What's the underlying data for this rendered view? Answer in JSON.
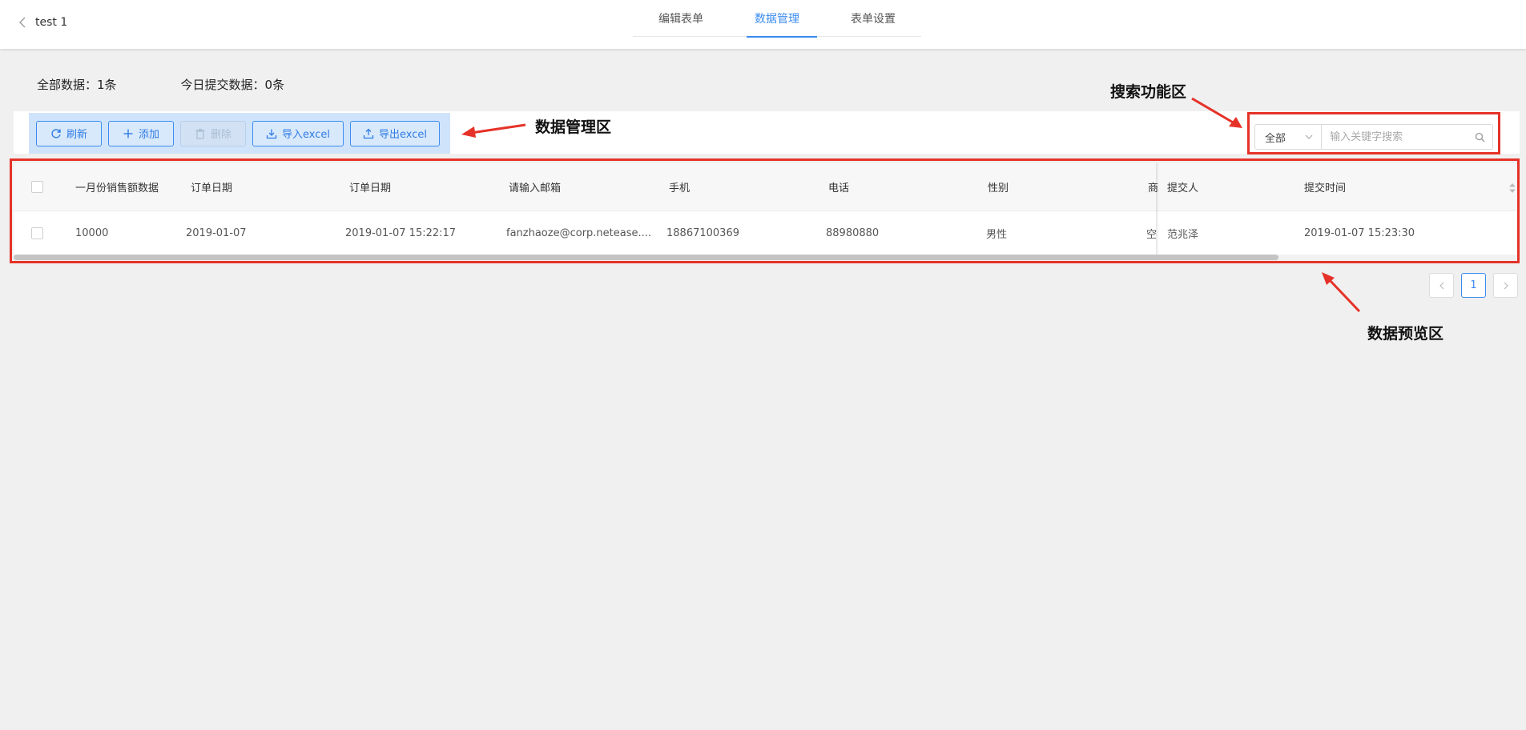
{
  "header": {
    "back_label": "test 1",
    "tabs": [
      {
        "label": "编辑表单",
        "active": false
      },
      {
        "label": "数据管理",
        "active": true
      },
      {
        "label": "表单设置",
        "active": false
      }
    ]
  },
  "stats": {
    "total": "全部数据：1条",
    "today": "今日提交数据：0条"
  },
  "toolbar": {
    "refresh": "刷新",
    "add": "添加",
    "delete": "删除",
    "import": "导入excel",
    "export": "导出excel"
  },
  "search": {
    "scope": "全部",
    "placeholder": "输入关键字搜索"
  },
  "table": {
    "columns": [
      "一月份销售额数据",
      "订单日期",
      "订单日期",
      "请输入邮箱",
      "手机",
      "电话",
      "性别",
      "商",
      "提交人",
      "提交时间"
    ],
    "rows": [
      [
        "10000",
        "2019-01-07",
        "2019-01-07 15:22:17",
        "fanzhaoze@corp.netease....",
        "18867100369",
        "88980880",
        "男性",
        "空",
        "范兆泽",
        "2019-01-07 15:23:30"
      ]
    ],
    "scroll_fraction": 0.84
  },
  "pagination": {
    "current": "1"
  },
  "annotations": {
    "manage": "数据管理区",
    "search": "搜索功能区",
    "preview": "数据预览区"
  },
  "colors": {
    "accent": "#3b8cf0",
    "annotation": "#e53228",
    "toolbar_bg": "#cfe3fb",
    "page_bg": "#f0f0f0"
  },
  "icons": [
    "chevron-left-icon",
    "refresh-icon",
    "plus-icon",
    "trash-icon",
    "download-icon",
    "upload-icon",
    "chevron-down-icon",
    "search-icon",
    "sort-icon",
    "chevron-right-icon"
  ]
}
